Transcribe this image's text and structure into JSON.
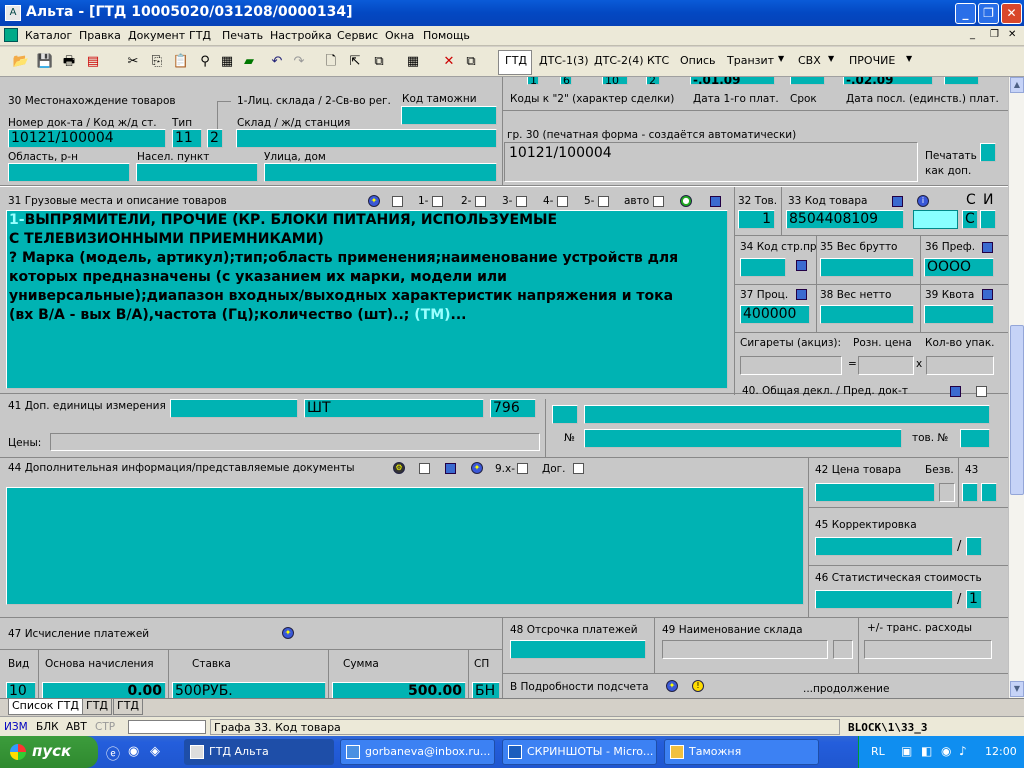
{
  "window": {
    "title": "Альта - [ГТД 10005020/031208/0000134]"
  },
  "menu": [
    "Каталог",
    "Правка",
    "Документ",
    "ГТД",
    "Печать",
    "Настройка",
    "Сервис",
    "Окна",
    "Помощь"
  ],
  "doc_tabs": [
    "ГТД",
    "ДТС-1(3)",
    "ДТС-2(4)",
    "КТС",
    "Опись",
    "Транзит",
    "СВХ",
    "ПРОЧИЕ"
  ],
  "top_strip": {
    "a": "1",
    "b": "6",
    "c": "10",
    "d": "2",
    "date1": "-.01.09",
    "date2": "-.02.09",
    "l1": "Коды к \"2\" (характер сделки)",
    "l2": "Дата 1-го плат.",
    "l3": "Срок",
    "l4": "Дата посл. (единств.) плат."
  },
  "b30": {
    "title": "30 Местонахождение товаров",
    "types": "1-Лиц. склада / 2-Св-во рег.",
    "customs_code": "Код таможни",
    "doc_label": "Номер док-та / Код ж/д ст.",
    "doc_value": "10121/100004",
    "type_label": "Тип",
    "type_value": "11",
    "type2_value": "2",
    "warehouse_label": "Склад / ж/д станция",
    "region": "Область, р-н",
    "city": "Насел. пункт",
    "street": "Улица, дом",
    "print_label": "гр. 30 (печатная форма - создаётся автоматически)",
    "print_value": "10121/100004",
    "print_as_add": "Печатать",
    "print_as_add2": "как доп."
  },
  "b31": {
    "title": "31 Грузовые места и описание товаров",
    "t1": "1-",
    "t2": "2-",
    "t3": "3-",
    "t4": "4-",
    "t5": "5-",
    "auto": "авто",
    "lines": [
      "ВЫПРЯМИТЕЛИ, ПРОЧИЕ (КР. БЛОКИ ПИТАНИЯ, ИСПОЛЬЗУЕМЫЕ",
      "С ТЕЛЕВИЗИОННЫМИ ПРИЕМНИКАМИ)",
      "? Марка (модель, артикул);тип;область применения;наименование устройств для",
      "которых предназначены (с указанием их марки, модели или",
      "универсальные);диапазон входных/выходных характеристик напряжения и тока",
      "(вх В/А - вых В/А),частота (Гц);количество (шт)..; "
    ],
    "line1_prefix": "1-",
    "tm": "(ТМ)",
    "dots": "..."
  },
  "b32": {
    "label": "32 Тов.",
    "value": "1"
  },
  "b33": {
    "label": "33 Код товара",
    "value": "8504408109",
    "c": "С",
    "i": "И",
    "cval": "С"
  },
  "b34": {
    "label": "34 Код стр.пр"
  },
  "b35": {
    "label": "35 Вес брутто"
  },
  "b36": {
    "label": "36 Преф.",
    "value": "ОООО"
  },
  "b37": {
    "label": "37 Проц.",
    "value": "400000"
  },
  "b38": {
    "label": "38 Вес нетто"
  },
  "b39": {
    "label": "39 Квота"
  },
  "excise": {
    "cig": "Сигареты (акциз):",
    "retail": "Розн. цена",
    "pack": "Кол-во упак.",
    "eq": "=",
    "x": "x"
  },
  "b40": {
    "label": "40. Общая декл. / Пред. док-т",
    "no": "№",
    "item_no": "тов. №"
  },
  "b41": {
    "label": "41 Доп. единицы измерения",
    "unit": "ШТ",
    "code": "796",
    "prices": "Цены:"
  },
  "b44": {
    "label": "44 Дополнительная информация/представляемые документы",
    "x9": "9.х-",
    "dog": "Дог."
  },
  "b42": {
    "label": "42 Цена товара",
    "free": "Безв."
  },
  "b43": {
    "label": "43"
  },
  "b45": {
    "label": "45 Корректировка",
    "slash": "/"
  },
  "b46": {
    "label": "46 Статистическая стоимость",
    "slash": "/",
    "value": "1"
  },
  "b47": {
    "label": "47 Исчисление платежей",
    "h_type": "Вид",
    "h_base": "Основа начисления",
    "h_rate": "Ставка",
    "h_sum": "Сумма",
    "h_sp": "СП",
    "type": "10",
    "base": "0.00",
    "rate": "500РУБ.",
    "sum": "500.00",
    "sp": "БН"
  },
  "b48": {
    "label": "48 Отсрочка платежей"
  },
  "b49": {
    "label": "49 Наименование склада"
  },
  "trans": {
    "label": "+/-  транс. расходы"
  },
  "bdet": {
    "label": "В Подробности подсчета",
    "cont": "...продолжение"
  },
  "sheet_tabs": [
    "Список ГТД",
    "ГТД",
    "ГТД"
  ],
  "status": {
    "izm": "ИЗМ",
    "blk": "БЛК",
    "avt": "АВТ",
    "str": "СТР",
    "hint": "Графа 33. Код товара",
    "block": "BLOCK\\1\\33_3"
  },
  "taskbar": {
    "start": "пуск",
    "tasks": [
      "ГТД Альта",
      "gorbaneva@inbox.ru...",
      "СКРИНШОТЫ - Micro...",
      "Таможня"
    ],
    "lang": "RL",
    "time": "12:00"
  }
}
